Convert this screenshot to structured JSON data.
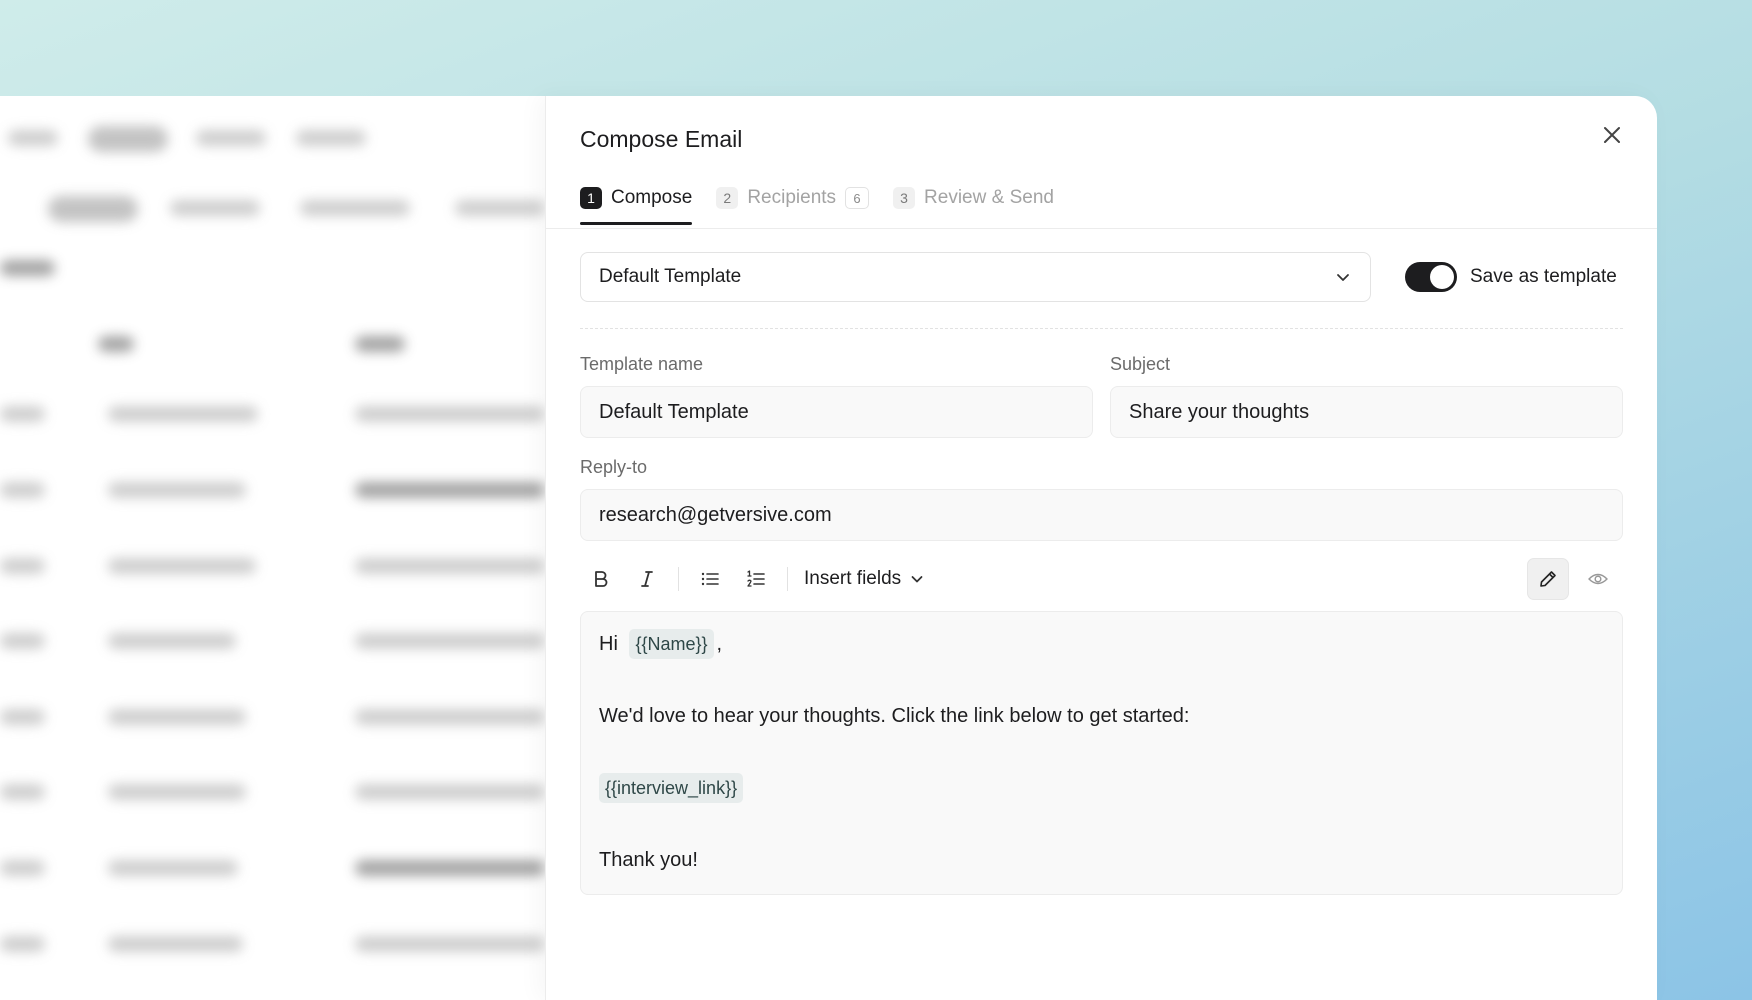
{
  "drawer": {
    "title": "Compose Email",
    "close_icon": "close-icon"
  },
  "steps": [
    {
      "number": "1",
      "label": "Compose",
      "active": true
    },
    {
      "number": "2",
      "label": "Recipients",
      "count": "6",
      "active": false
    },
    {
      "number": "3",
      "label": "Review & Send",
      "active": false
    }
  ],
  "template_select": {
    "value": "Default Template",
    "icon": "chevron-down-icon"
  },
  "save_template": {
    "label": "Save as template",
    "enabled": true
  },
  "fields": {
    "template_name": {
      "label": "Template name",
      "value": "Default Template"
    },
    "subject": {
      "label": "Subject",
      "value": "Share your thoughts"
    },
    "reply_to": {
      "label": "Reply-to",
      "value": "research@getversive.com"
    }
  },
  "toolbar": {
    "bold_icon": "bold-icon",
    "italic_icon": "italic-icon",
    "bullet_list_icon": "bullet-list-icon",
    "numbered_list_icon": "numbered-list-icon",
    "insert_fields_label": "Insert fields",
    "edit_icon": "pencil-icon",
    "preview_icon": "eye-icon"
  },
  "body": {
    "greeting_prefix": "Hi ",
    "name_token": "{{Name}}",
    "greeting_suffix": ",",
    "message": "We'd love to hear your thoughts. Click the link below to get started:",
    "link_token": "{{interview_link}}",
    "closing": "Thank you!"
  },
  "colors": {
    "primary": "#1d1d1f",
    "muted": "#a3a3a3",
    "chip_bg": "#e7ecec",
    "field_bg": "#f9f9f9"
  }
}
